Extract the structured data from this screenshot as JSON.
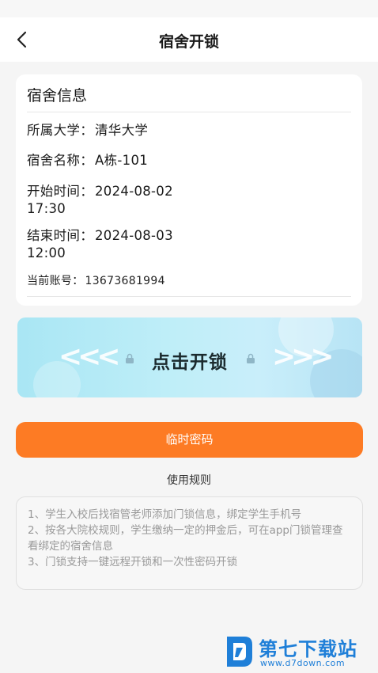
{
  "header": {
    "title": "宿舍开锁"
  },
  "info_card": {
    "title": "宿舍信息",
    "rows": [
      {
        "label": "所属大学：",
        "value": "清华大学"
      },
      {
        "label": "宿舍名称：",
        "value": "A栋-101"
      },
      {
        "label": "开始时间：",
        "value": "2024-08-02",
        "value2": "17:30"
      },
      {
        "label": "结束时间：",
        "value": "2024-08-03",
        "value2": "12:00"
      },
      {
        "label": "当前账号：",
        "value": "13673681994"
      }
    ]
  },
  "unlock": {
    "label": "点击开锁",
    "left_arrows": "<<<",
    "right_arrows": ">>>"
  },
  "temp_password": {
    "label": "临时密码"
  },
  "rules": {
    "title": "使用规则",
    "lines": [
      "1、学生入校后找宿管老师添加门锁信息，绑定学生手机号",
      "2、按各大院校规则，学生缴纳一定的押金后，可在app门锁管理查看绑定的宿舍信息",
      "3、门锁支持一键远程开锁和一次性密码开锁"
    ]
  },
  "watermark": {
    "name": "第七下载站",
    "url": "www.d7down.com"
  },
  "colors": {
    "accent_orange": "#fd7b24",
    "banner_blue": "#bfeef8",
    "watermark_blue": "#1f7fd8"
  }
}
